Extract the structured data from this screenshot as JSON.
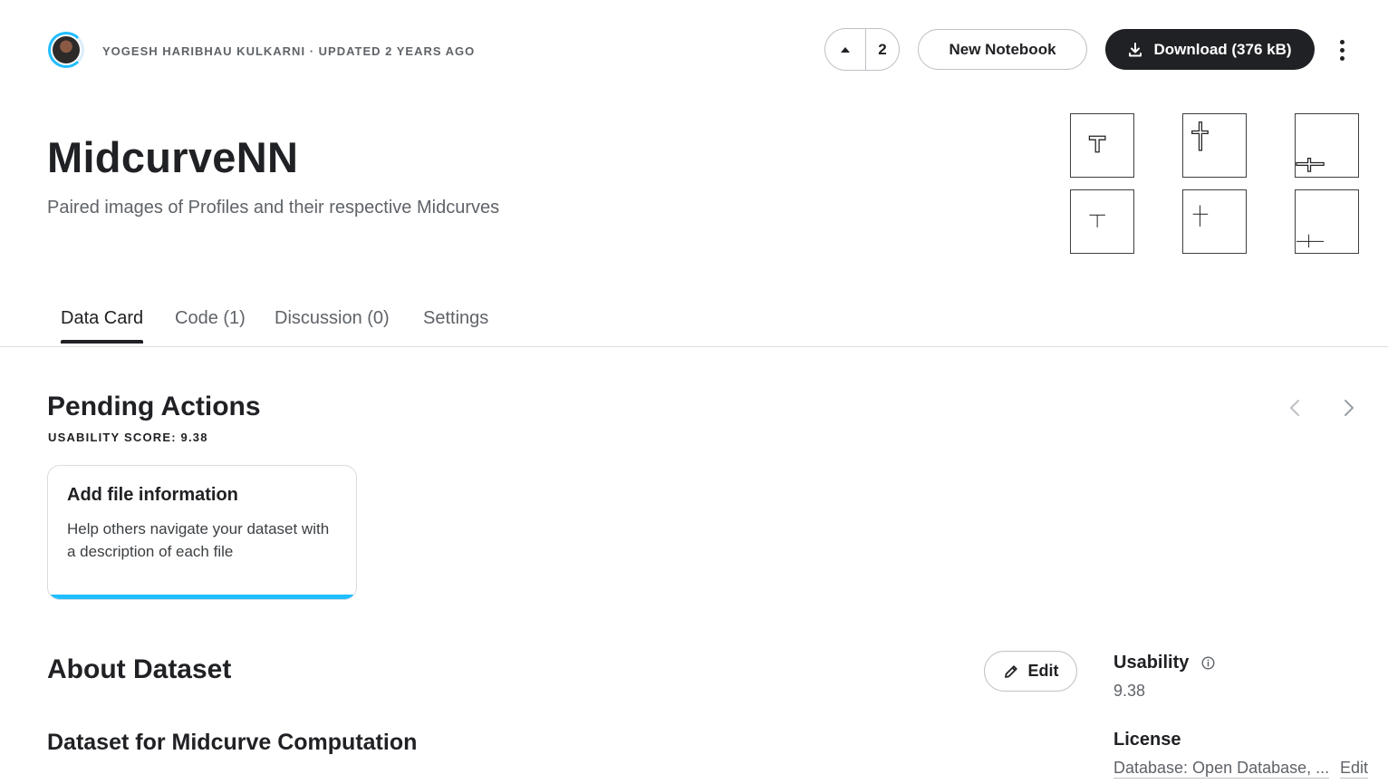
{
  "header": {
    "author": "YOGESH HARIBHAU KULKARNI",
    "separator": "·",
    "updated": "UPDATED 2 YEARS AGO",
    "vote_count": "2",
    "new_notebook_label": "New Notebook",
    "download_label": "Download (376 kB)"
  },
  "dataset": {
    "title": "MidcurveNN",
    "subtitle": "Paired images of Profiles and their respective Midcurves"
  },
  "tabs": [
    {
      "label": "Data Card"
    },
    {
      "label": "Code (1)"
    },
    {
      "label": "Discussion (0)"
    },
    {
      "label": "Settings"
    }
  ],
  "pending": {
    "title": "Pending Actions",
    "score_label": "USABILITY SCORE: 9.38",
    "card": {
      "title": "Add file information",
      "text": "Help others navigate your dataset with a description of each file"
    }
  },
  "about": {
    "title": "About Dataset",
    "edit_label": "Edit",
    "section_title": "Dataset for Midcurve Computation"
  },
  "sidebar": {
    "usability_label": "Usability",
    "usability_value": "9.38",
    "license_label": "License",
    "license_value": "Database: Open Database, ...",
    "license_edit": "Edit"
  },
  "colors": {
    "accent": "#20beff",
    "dark": "#202124",
    "muted": "#5f6368",
    "border": "#dadce0"
  }
}
